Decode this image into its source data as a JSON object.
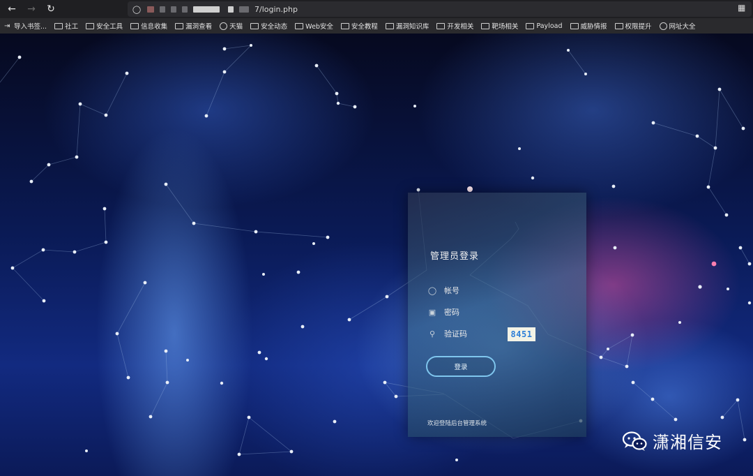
{
  "browser": {
    "url_suffix": "7/login.php",
    "bookmarks": [
      {
        "label": "导入书签...",
        "icon": "import-icon"
      },
      {
        "label": "社工",
        "icon": "folder-icon"
      },
      {
        "label": "安全工具",
        "icon": "folder-icon"
      },
      {
        "label": "信息收集",
        "icon": "folder-icon"
      },
      {
        "label": "漏洞查看",
        "icon": "folder-icon"
      },
      {
        "label": "天猫",
        "icon": "globe-icon"
      },
      {
        "label": "安全动态",
        "icon": "folder-icon"
      },
      {
        "label": "Web安全",
        "icon": "folder-icon"
      },
      {
        "label": "安全教程",
        "icon": "folder-icon"
      },
      {
        "label": "漏洞知识库",
        "icon": "folder-icon"
      },
      {
        "label": "开发相关",
        "icon": "folder-icon"
      },
      {
        "label": "靶场相关",
        "icon": "folder-icon"
      },
      {
        "label": "Payload",
        "icon": "folder-icon"
      },
      {
        "label": "威胁情报",
        "icon": "folder-icon"
      },
      {
        "label": "权限提升",
        "icon": "folder-icon"
      },
      {
        "label": "网址大全",
        "icon": "globe-icon"
      }
    ]
  },
  "login": {
    "title": "管理员登录",
    "account_label": "帐号",
    "password_label": "密码",
    "captcha_label": "验证码",
    "captcha_code": "8451",
    "button_label": "登录",
    "welcome": "欢迎登陆后台管理系统"
  },
  "watermark": {
    "text": "潇湘信安"
  }
}
